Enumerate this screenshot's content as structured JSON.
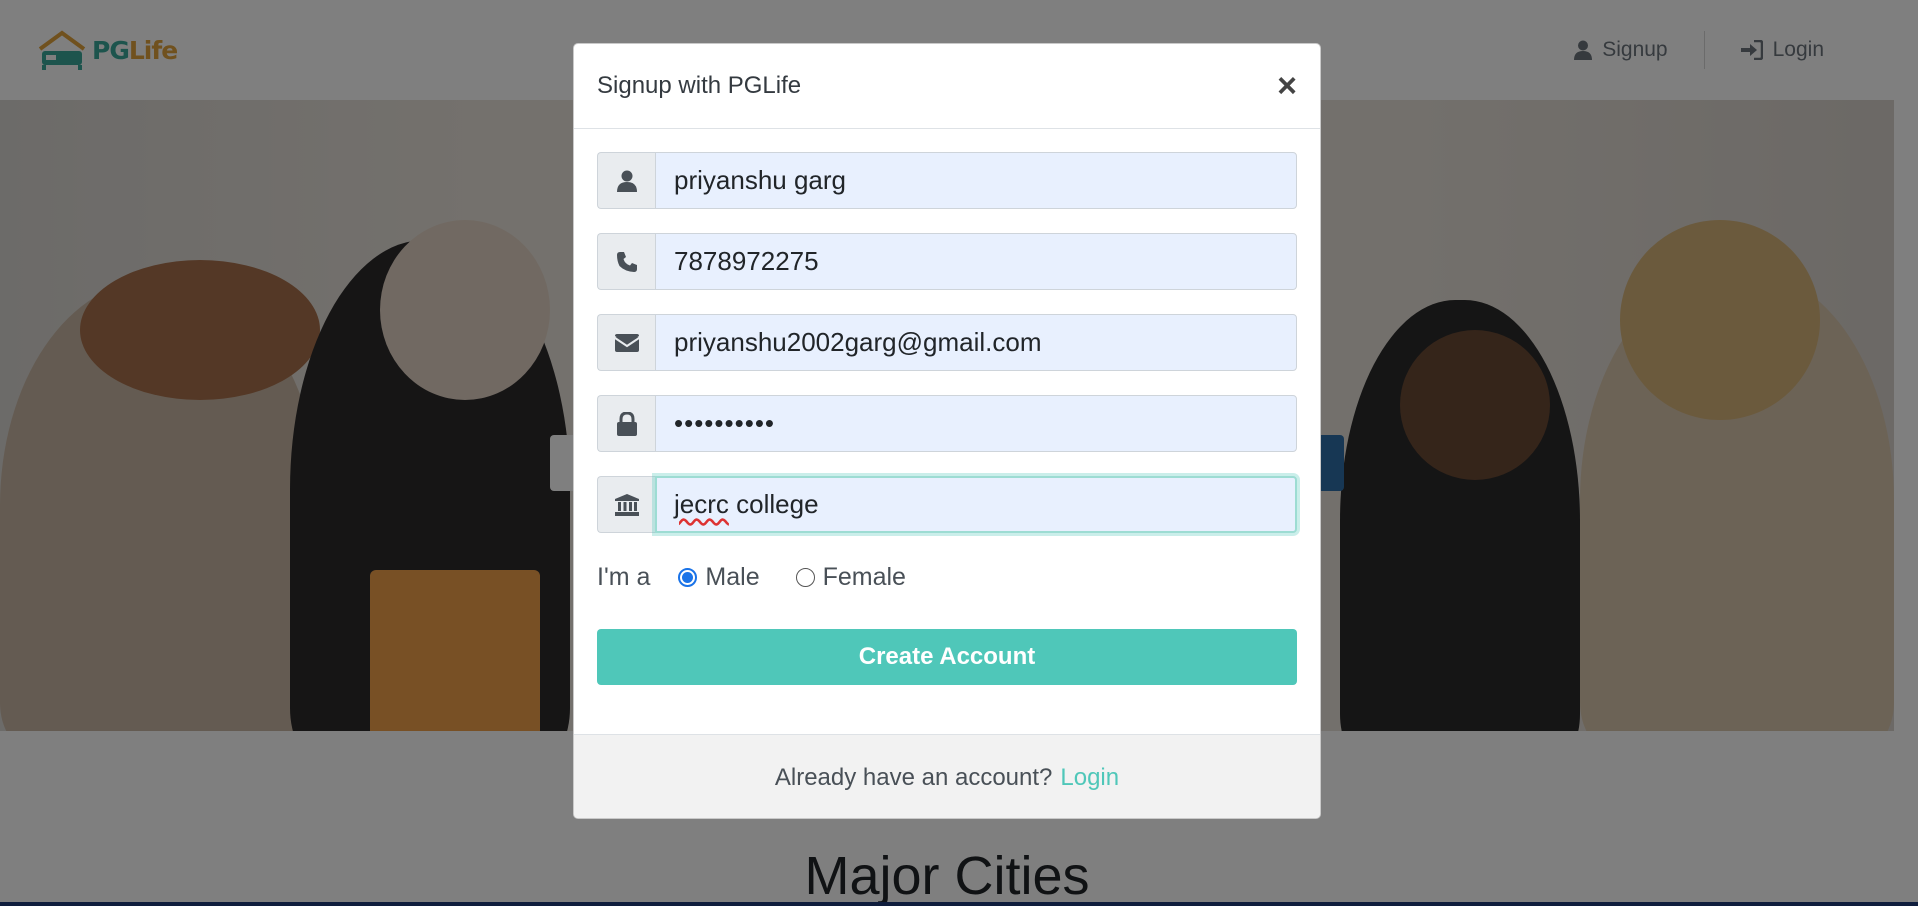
{
  "navbar": {
    "logo": {
      "pg": "PG",
      "life": "Life"
    },
    "signup_label": "Signup",
    "login_label": "Login"
  },
  "hero": {
    "section_title": "Major Cities"
  },
  "modal": {
    "title": "Signup with PGLife",
    "close_symbol": "×",
    "fields": {
      "full_name": {
        "value": "priyanshu garg",
        "icon": "user-icon"
      },
      "phone": {
        "value": "7878972275",
        "icon": "phone-icon"
      },
      "email": {
        "value": "priyanshu2002garg@gmail.com",
        "icon": "envelope-icon"
      },
      "password": {
        "value": "••••••••••",
        "icon": "lock-icon"
      },
      "college": {
        "value_prefix": "jecrc",
        "value_suffix": " college",
        "icon": "university-icon"
      }
    },
    "gender": {
      "label": "I'm a",
      "options": [
        "Male",
        "Female"
      ],
      "selected": "Male"
    },
    "submit_label": "Create Account",
    "footer": {
      "text": "Already have an account?",
      "link": "Login"
    }
  },
  "colors": {
    "accent": "#4fc7b9",
    "radio": "#1a73e8",
    "input_bg": "#e8f0fe"
  }
}
